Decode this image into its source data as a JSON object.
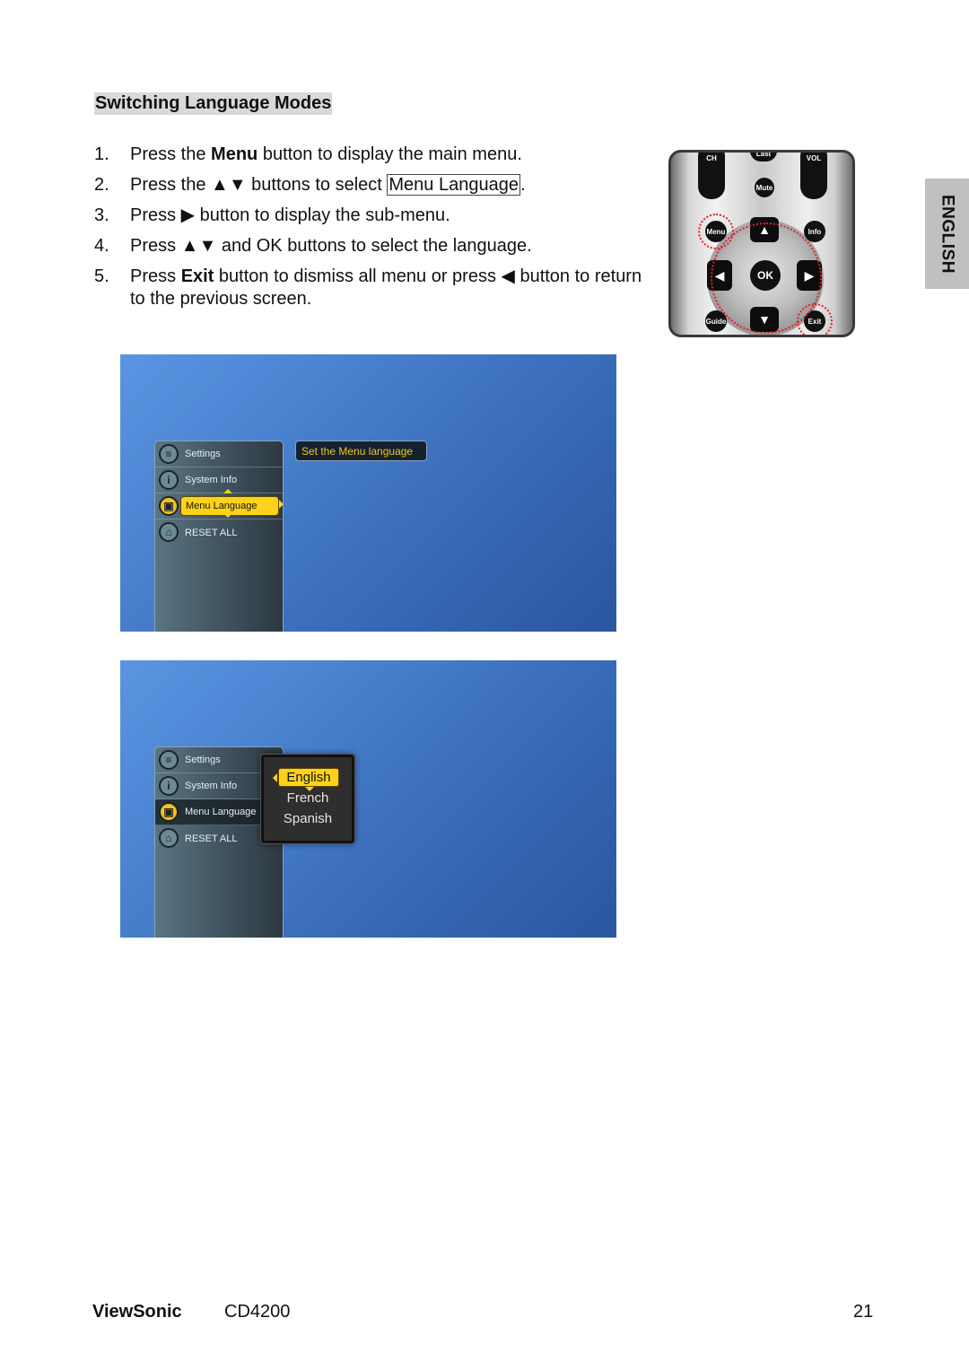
{
  "section": {
    "title": "Switching Language Modes"
  },
  "steps": [
    {
      "num": "1.",
      "pre": "Press the ",
      "bold": "Menu",
      "post": " button to display the main menu."
    },
    {
      "num": "2.",
      "pre": "Press the ▲▼ buttons to select ",
      "boxed": "Menu Language",
      "post": "."
    },
    {
      "num": "3.",
      "text": "Press ▶ button to display the sub-menu."
    },
    {
      "num": "4.",
      "text": "Press ▲▼ and OK buttons to select the language."
    },
    {
      "num": "5.",
      "pre": "Press ",
      "bold": "Exit",
      "post": " button to dismiss all menu or press ◀ button to return to the previous screen."
    }
  ],
  "remote": {
    "buttons": {
      "last": "Last",
      "ch": "CH",
      "vol": "VOL",
      "mute": "Mute",
      "menu": "Menu",
      "info": "Info",
      "ok": "OK",
      "guide": "Guide",
      "exit": "Exit"
    },
    "arrows": {
      "up": "▲",
      "down": "▼",
      "left": "◀",
      "right": "▶"
    },
    "highlight_color": "#e0202a"
  },
  "side_tab": {
    "label": "ENGLISH"
  },
  "screen1": {
    "menu_items": [
      {
        "label": "Settings",
        "icon": "sliders-icon"
      },
      {
        "label": "System Info",
        "icon": "info-icon"
      },
      {
        "label": "Menu Language",
        "icon": "language-icon",
        "selected": true
      },
      {
        "label": "RESET ALL",
        "icon": "home-reset-icon"
      }
    ],
    "tooltip": "Set the Menu language"
  },
  "screen2": {
    "menu_items": [
      {
        "label": "Settings",
        "icon": "sliders-icon"
      },
      {
        "label": "System Info",
        "icon": "info-icon"
      },
      {
        "label": "Menu Language",
        "icon": "language-icon",
        "selected": true
      },
      {
        "label": "RESET ALL",
        "icon": "home-reset-icon"
      }
    ],
    "languages": [
      "English",
      "French",
      "Spanish"
    ],
    "selected_language": "English"
  },
  "colors": {
    "highlight": "#ffd21a",
    "osd_background": "#3a6dbb",
    "tooltip_text": "#f2c21c"
  },
  "footer": {
    "brand": "ViewSonic",
    "model": "CD4200",
    "page": "21"
  }
}
